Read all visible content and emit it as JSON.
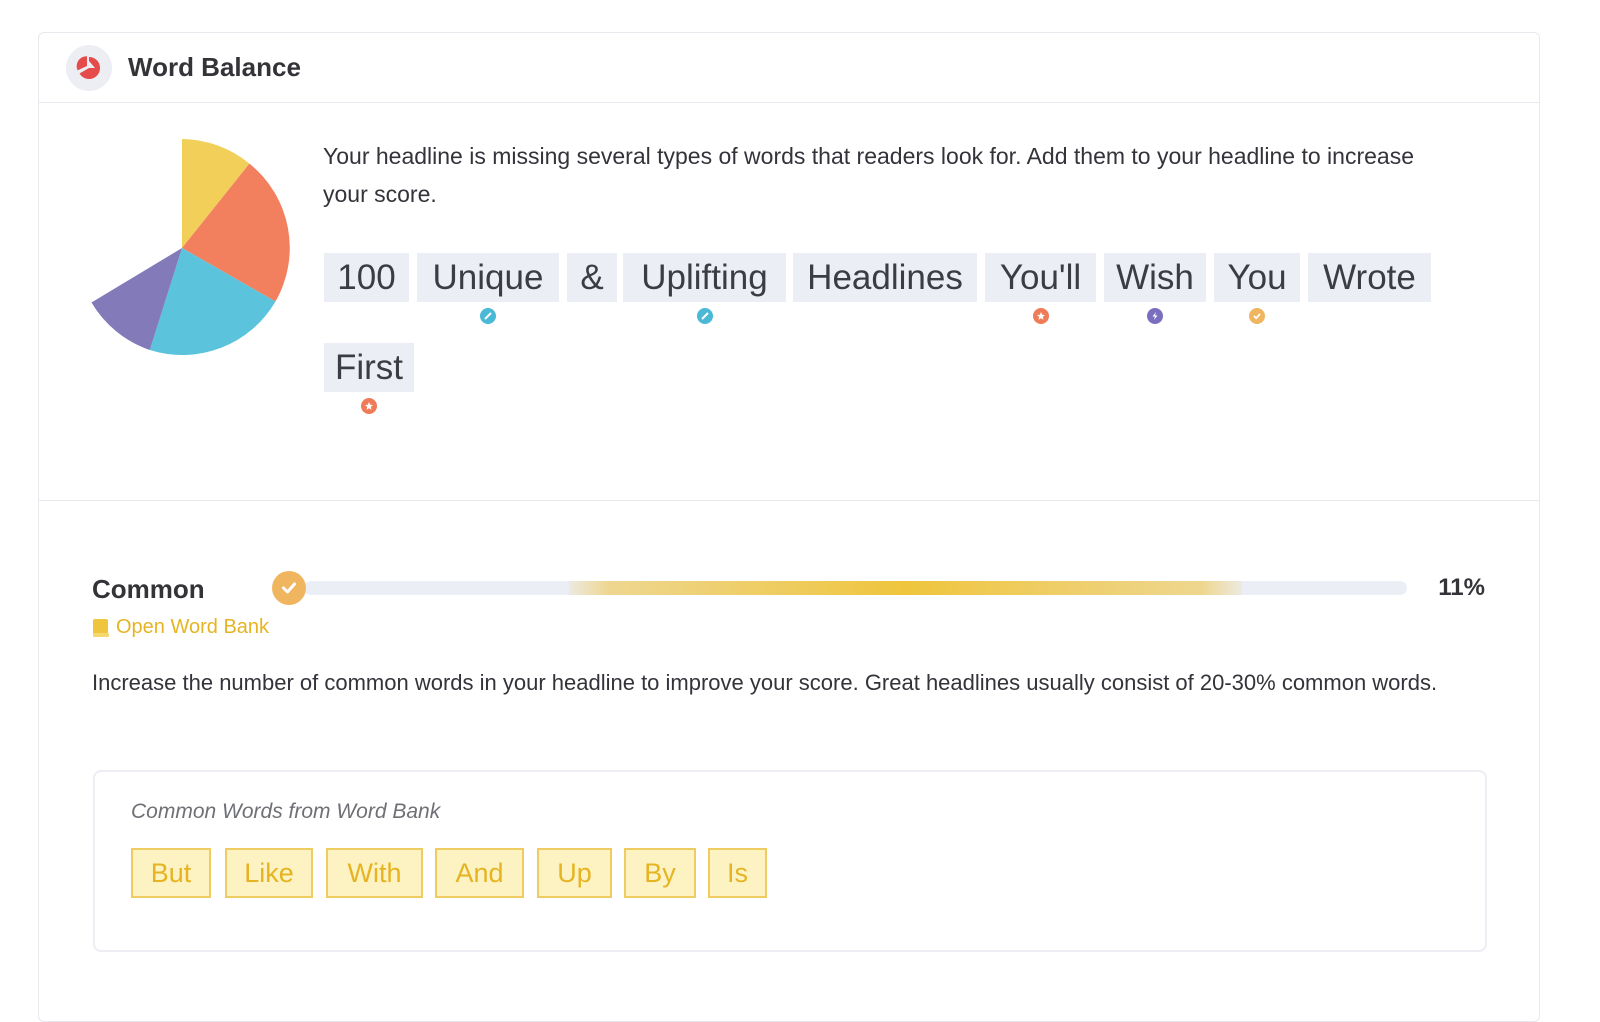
{
  "card": {
    "title": "Word Balance",
    "header_icon": "pie-chart-icon"
  },
  "intro": "Your headline is missing several types of words that readers look for. Add them to your headline to increase your score.",
  "pie_chart": {
    "type": "pie",
    "slices": [
      {
        "category": "common",
        "color": "#f1cf59"
      },
      {
        "category": "emotional",
        "color": "#f2805f"
      },
      {
        "category": "uncommon",
        "color": "#5bc3dc"
      },
      {
        "category": "power",
        "color": "#837ab9"
      }
    ],
    "has_gap": true
  },
  "headline_words": [
    {
      "text": "100",
      "marker": null
    },
    {
      "text": "Unique",
      "marker": "uncommon",
      "marker_color": "#49b9d6"
    },
    {
      "text": "&",
      "marker": null
    },
    {
      "text": "Uplifting",
      "marker": "uncommon",
      "marker_color": "#49b9d6"
    },
    {
      "text": "Headlines",
      "marker": null
    },
    {
      "text": "You'll",
      "marker": "emotional",
      "marker_color": "#f07b58"
    },
    {
      "text": "Wish",
      "marker": "power",
      "marker_color": "#7a6fbf"
    },
    {
      "text": "You",
      "marker": "common",
      "marker_color": "#efb65f"
    },
    {
      "text": "Wrote",
      "marker": null
    },
    {
      "text": "First",
      "marker": "emotional",
      "marker_color": "#f07b58"
    }
  ],
  "common": {
    "label": "Common",
    "percent_label": "11%",
    "percent": 11,
    "bar_color": "#efc53d",
    "open_bank_label": "Open Word Bank",
    "description": "Increase the number of common words in your headline to improve your score. Great headlines usually consist of 20-30% common words.",
    "bank_title": "Common Words from Word Bank",
    "bank_words": [
      "But",
      "Like",
      "With",
      "And",
      "Up",
      "By",
      "Is"
    ]
  }
}
